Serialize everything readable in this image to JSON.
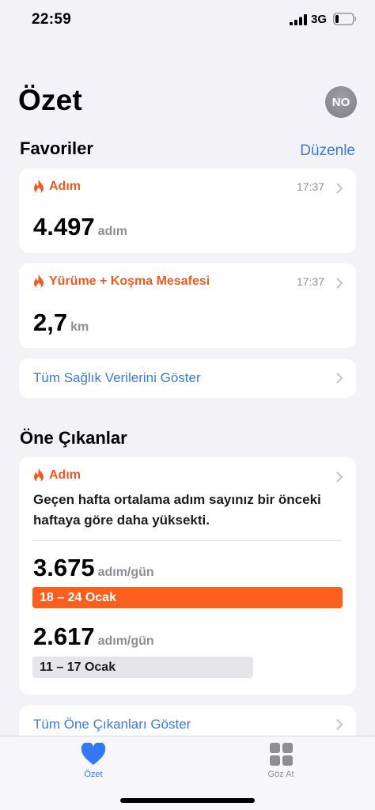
{
  "status_bar": {
    "time": "22:59",
    "network": "3G"
  },
  "header": {
    "title": "Özet",
    "avatar_initials": "NO"
  },
  "favorites": {
    "title": "Favoriler",
    "edit_label": "Düzenle",
    "cards": [
      {
        "label": "Adım",
        "time": "17:37",
        "value": "4.497",
        "unit": "adım"
      },
      {
        "label": "Yürüme + Koşma Mesafesi",
        "time": "17:37",
        "value": "2,7",
        "unit": "km"
      }
    ],
    "show_all_label": "Tüm Sağlık Verilerini Göster"
  },
  "highlights": {
    "title": "Öne Çıkanlar",
    "card": {
      "label": "Adım",
      "text": "Geçen hafta ortalama adım sayınız bir önceki haftaya göre daha yüksekti.",
      "current": {
        "value": "3.675",
        "unit": "adım/gün",
        "range": "18 – 24 Ocak"
      },
      "previous": {
        "value": "2.617",
        "unit": "adım/gün",
        "range": "11 – 17 Ocak"
      }
    },
    "show_all_label": "Tüm Öne Çıkanları Göster"
  },
  "tab_bar": {
    "tabs": [
      {
        "label": "Özet",
        "icon": "heart-icon",
        "active": true
      },
      {
        "label": "Göz At",
        "icon": "grid-icon",
        "active": false
      }
    ]
  },
  "colors": {
    "accent_orange": "#f05a22",
    "link_blue": "#3a7bd5",
    "tab_active": "#3478f6",
    "tab_inactive": "#8e8e93"
  }
}
